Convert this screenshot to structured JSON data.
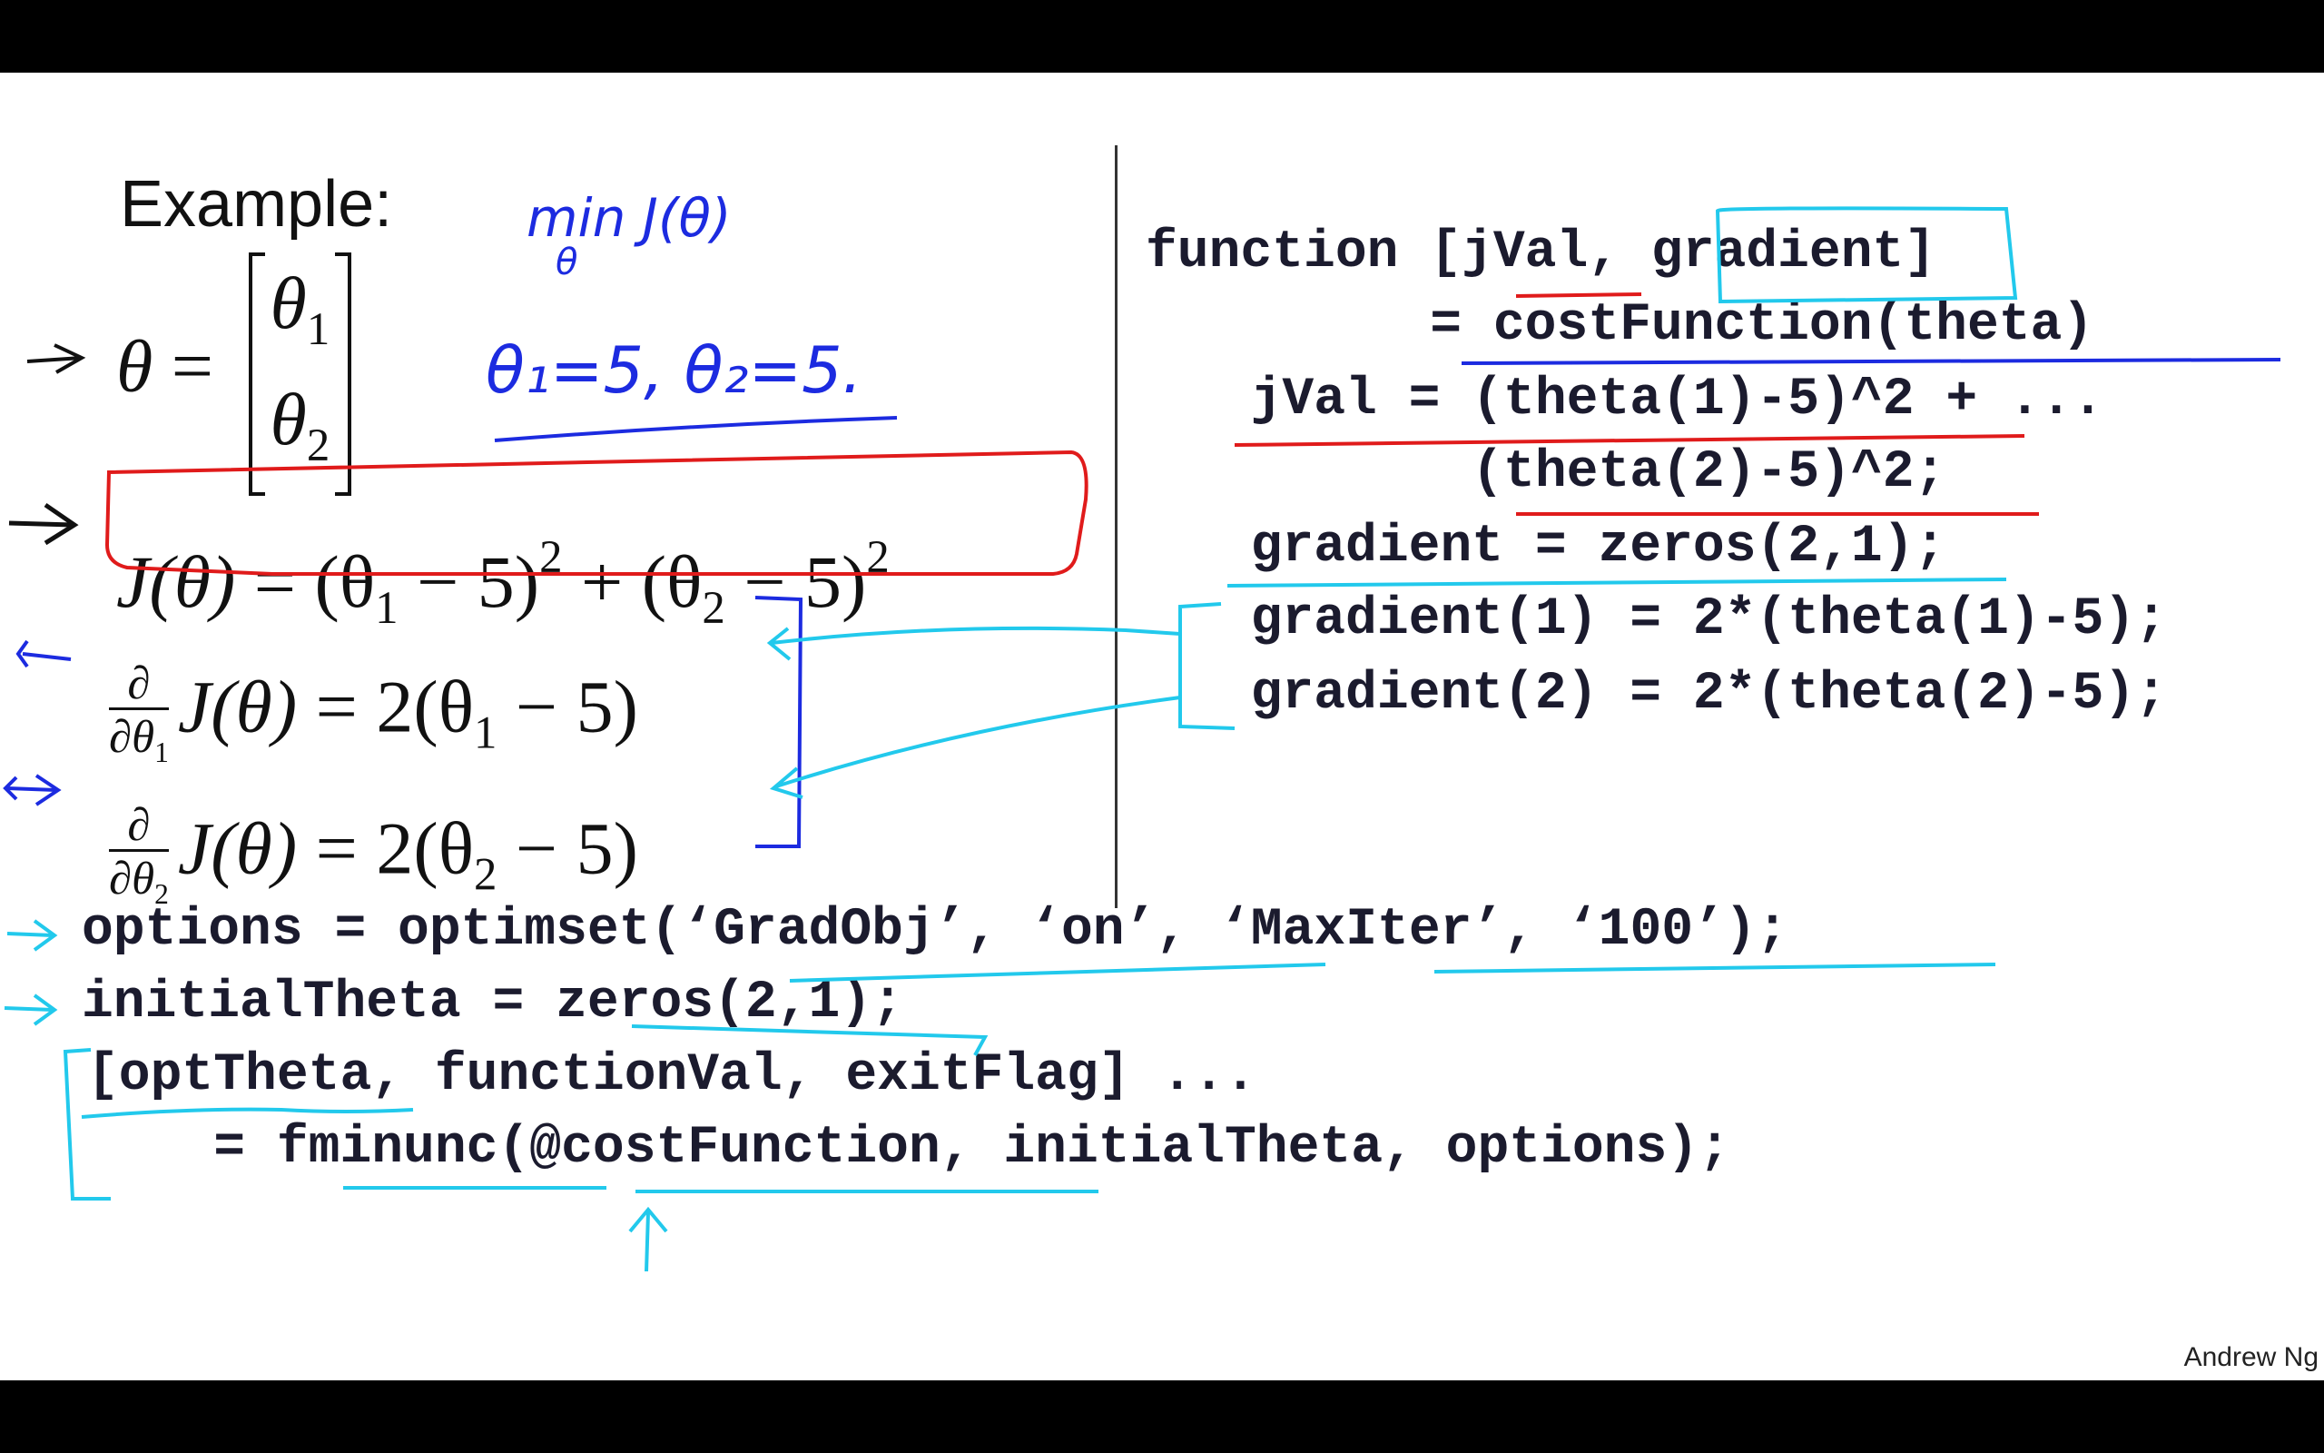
{
  "slide": {
    "heading": "Example:",
    "handwritten": {
      "min_note": "min J(θ)",
      "min_sub": "θ",
      "theta_values": "θ₁=5, θ₂=5."
    },
    "math": {
      "theta_symbol": "θ",
      "equals": "=",
      "theta1": "θ",
      "theta1_sub": "1",
      "theta2": "θ",
      "theta2_sub": "2",
      "cost_lhs": "J(θ)",
      "cost_rhs_a": "(θ",
      "cost_rhs_a_sub": "1",
      "cost_rhs_a_tail": " − 5)",
      "cost_rhs_a_sup": "2",
      "plus": " + ",
      "cost_rhs_b": "(θ",
      "cost_rhs_b_sub": "2",
      "cost_rhs_b_tail": " − 5)",
      "cost_rhs_b_sup": "2",
      "partial": "∂",
      "d_theta": "∂θ",
      "d1_sub": "1",
      "d2_sub": "2",
      "d_lhs": "J(θ)",
      "d1_rhs": "2(θ",
      "d1_rhs_sub": "1",
      "d1_rhs_tail": " − 5)",
      "d2_rhs": "2(θ",
      "d2_rhs_sub": "2",
      "d2_rhs_tail": " − 5)"
    },
    "code_right": [
      "function [jVal, gradient]",
      "         = costFunction(theta)",
      "  jVal = (theta(1)-5)^2 + ...",
      "         (theta(2)-5)^2;",
      "  gradient = zeros(2,1);",
      "  gradient(1) = 2*(theta(1)-5);",
      "  gradient(2) = 2*(theta(2)-5);"
    ],
    "code_bottom": [
      "options = optimset(‘GradObj’, ‘on’, ‘MaxIter’, ‘100’);",
      "initialTheta = zeros(2,1);",
      "[optTheta, functionVal, exitFlag] ...",
      "    = fminunc(@costFunction, initialTheta, options);"
    ],
    "watermark": "Andrew Ng"
  },
  "colors": {
    "ink_red": "#e01b1b",
    "ink_blue": "#1c2be0",
    "ink_cyan": "#22c9ec",
    "text": "#111111"
  }
}
